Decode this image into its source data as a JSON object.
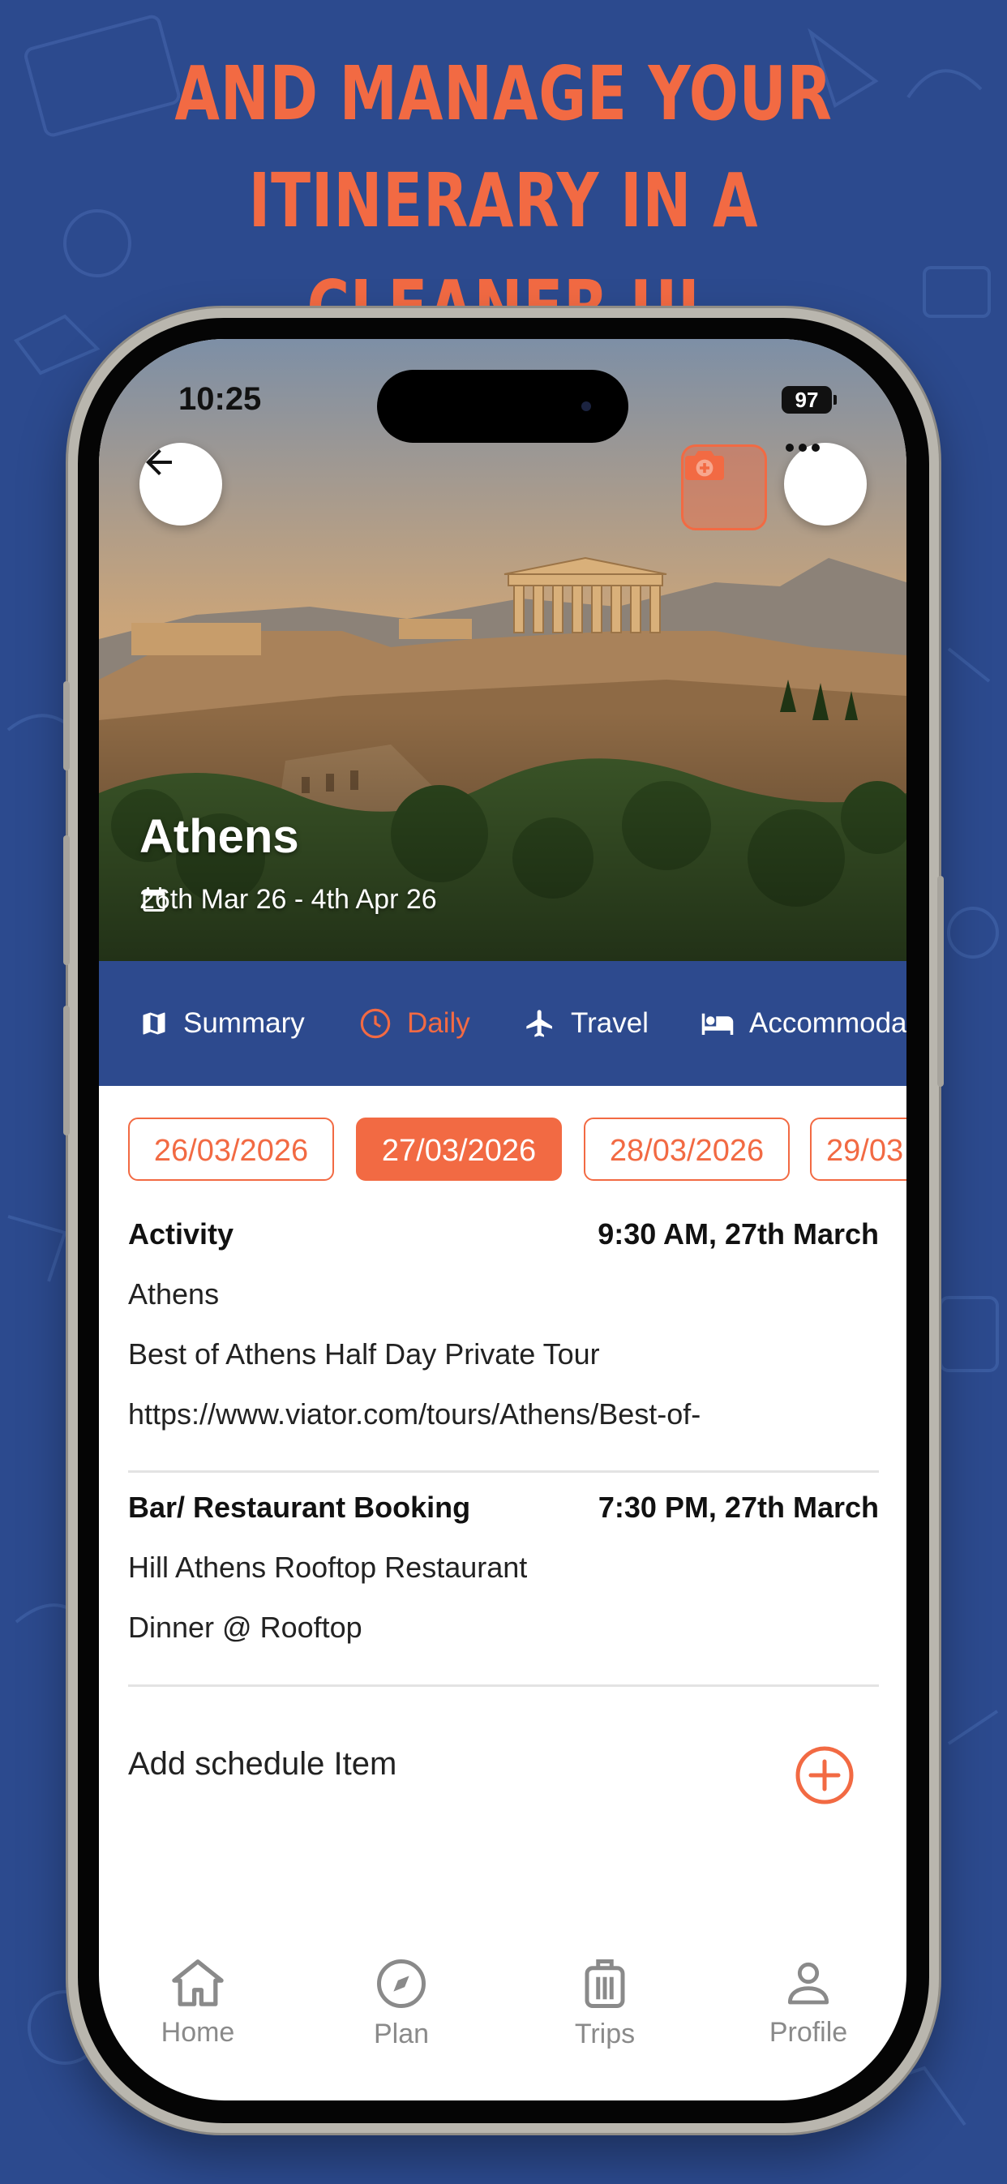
{
  "headline": {
    "line1": "AND MANAGE YOUR",
    "line2": "ITINERARY IN A CLEANER UI"
  },
  "colors": {
    "background": "#2c4a8e",
    "accent": "#f26a43",
    "tab_bar": "#2d4a8e"
  },
  "status_bar": {
    "time": "10:25",
    "battery": "97"
  },
  "trip": {
    "city": "Athens",
    "date_range": "26th Mar 26 - 4th Apr 26"
  },
  "tabs": [
    {
      "label": "Summary",
      "icon": "map-icon"
    },
    {
      "label": "Daily",
      "icon": "clock-icon",
      "active": true
    },
    {
      "label": "Travel",
      "icon": "airplane-icon"
    },
    {
      "label": "Accommoda",
      "icon": "bed-icon"
    }
  ],
  "date_chips": [
    "26/03/2026",
    "27/03/2026",
    "28/03/2026",
    "29/03"
  ],
  "selected_date": "27/03/2026",
  "schedule": [
    {
      "title": "Activity",
      "time": "9:30 AM, 27th March",
      "lines": [
        "Athens",
        "Best of Athens Half Day Private Tour",
        "https://www.viator.com/tours/Athens/Best-of-"
      ]
    },
    {
      "title": "Bar/ Restaurant Booking",
      "time": "7:30 PM, 27th March",
      "lines": [
        "Hill Athens Rooftop Restaurant",
        "Dinner @ Rooftop"
      ]
    }
  ],
  "add_item_label": "Add schedule Item",
  "nav": [
    {
      "label": "Home",
      "icon": "home-icon"
    },
    {
      "label": "Plan",
      "icon": "compass-icon"
    },
    {
      "label": "Trips",
      "icon": "suitcase-icon"
    },
    {
      "label": "Profile",
      "icon": "person-icon"
    }
  ]
}
